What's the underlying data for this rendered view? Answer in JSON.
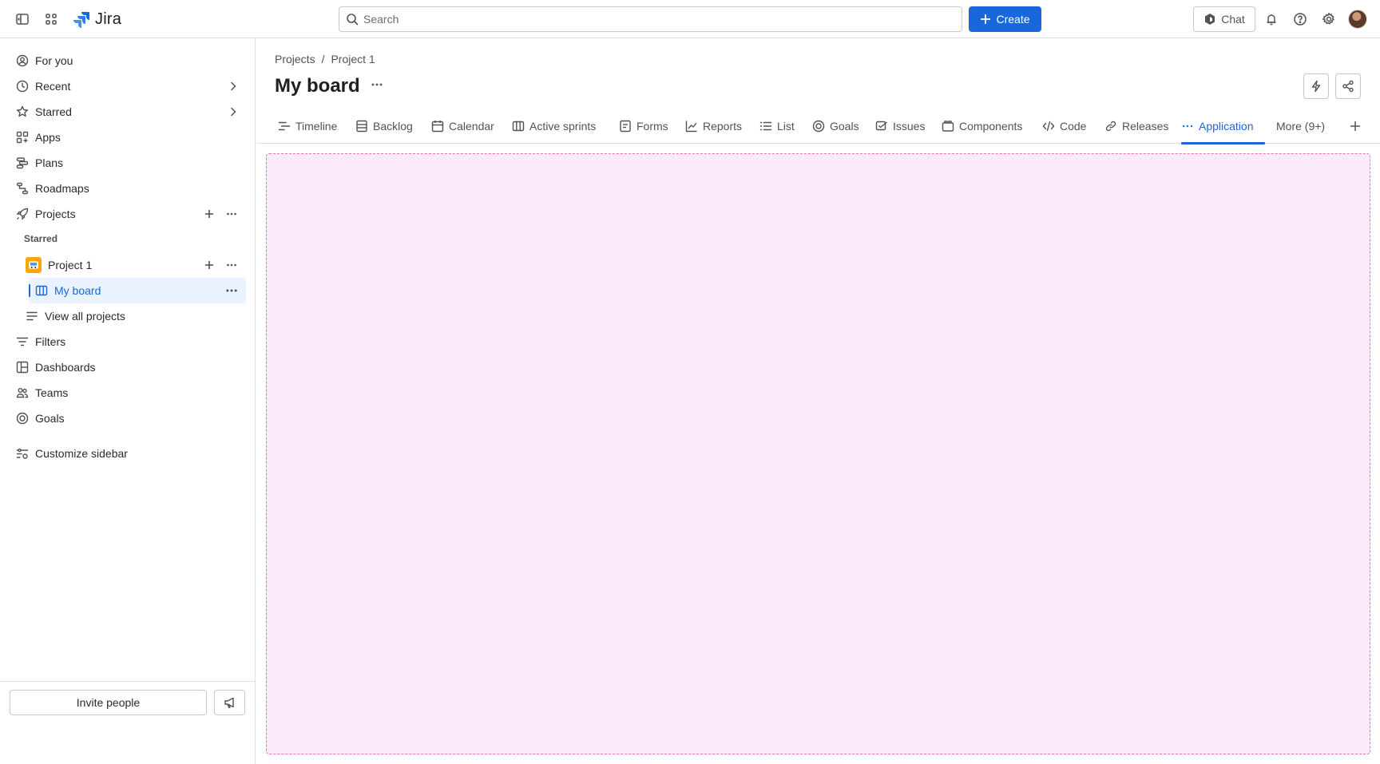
{
  "topbar": {
    "logo_text": "Jira",
    "search_placeholder": "Search",
    "create_label": "Create",
    "chat_label": "Chat"
  },
  "sidebar": {
    "items": [
      {
        "label": "For you",
        "icon": "user-circle-icon"
      },
      {
        "label": "Recent",
        "icon": "clock-icon"
      },
      {
        "label": "Starred",
        "icon": "star-icon"
      },
      {
        "label": "Apps",
        "icon": "apps-icon"
      },
      {
        "label": "Plans",
        "icon": "plans-icon"
      },
      {
        "label": "Roadmaps",
        "icon": "roadmap-icon"
      },
      {
        "label": "Projects",
        "icon": "rocket-icon"
      }
    ],
    "starred_section": "Starred",
    "project_name": "Project 1",
    "board_name": "My board",
    "view_all": "View all projects",
    "lower_items": [
      {
        "label": "Filters",
        "icon": "filter-icon"
      },
      {
        "label": "Dashboards",
        "icon": "dashboard-icon"
      },
      {
        "label": "Teams",
        "icon": "people-icon"
      },
      {
        "label": "Goals",
        "icon": "goal-icon"
      }
    ],
    "customize": "Customize sidebar",
    "invite": "Invite people"
  },
  "main": {
    "breadcrumb": [
      "Projects",
      "Project 1"
    ],
    "breadcrumb_sep": "/",
    "title": "My board",
    "tabs": [
      {
        "label": "Timeline",
        "icon": "timeline-icon"
      },
      {
        "label": "Backlog",
        "icon": "backlog-icon"
      },
      {
        "label": "Calendar",
        "icon": "calendar-icon"
      },
      {
        "label": "Active sprints",
        "icon": "board-icon"
      },
      {
        "label": "Forms",
        "icon": "form-icon"
      },
      {
        "label": "Reports",
        "icon": "chart-icon"
      },
      {
        "label": "List",
        "icon": "list-icon"
      },
      {
        "label": "Goals",
        "icon": "goal-icon"
      },
      {
        "label": "Issues",
        "icon": "issues-icon"
      },
      {
        "label": "Components",
        "icon": "component-icon"
      },
      {
        "label": "Code",
        "icon": "code-icon"
      },
      {
        "label": "Releases",
        "icon": "link-icon"
      },
      {
        "label": "Application",
        "icon": "more-icon",
        "active": true
      },
      {
        "label": "More (9+)"
      }
    ]
  },
  "colors": {
    "brand": "#1868DB",
    "selected_bg": "#E9F2FE",
    "app_frame_bg": "#FDEAF8",
    "app_frame_border": "#E774BB"
  }
}
